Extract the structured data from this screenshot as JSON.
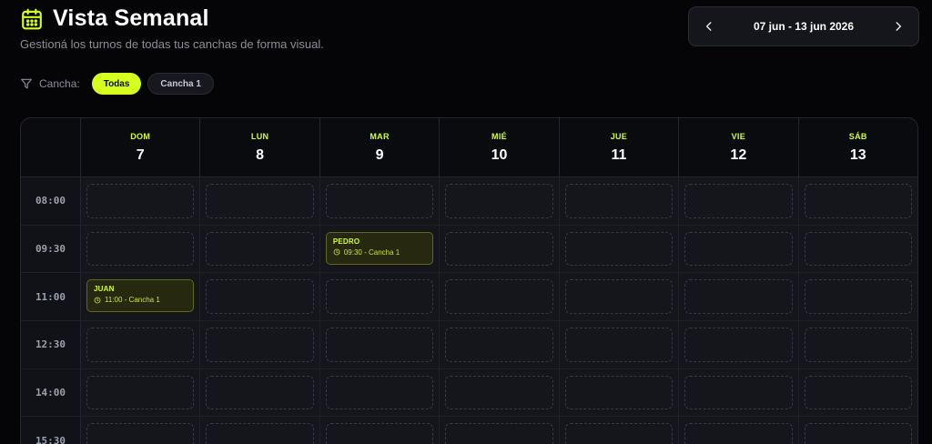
{
  "header": {
    "title": "Vista Semanal",
    "subtitle": "Gestioná los turnos de todas tus canchas de forma visual.",
    "icon": "calendar-icon"
  },
  "week_nav": {
    "range": "07 jun - 13 jun 2026",
    "prev_icon": "chevron-left-icon",
    "next_icon": "chevron-right-icon"
  },
  "filters": {
    "label": "Cancha:",
    "icon": "filter-icon",
    "options": [
      {
        "label": "Todas",
        "active": true
      },
      {
        "label": "Cancha 1",
        "active": false
      }
    ]
  },
  "calendar": {
    "days": [
      {
        "name": "DOM",
        "num": "7"
      },
      {
        "name": "LUN",
        "num": "8"
      },
      {
        "name": "MAR",
        "num": "9"
      },
      {
        "name": "MIÉ",
        "num": "10"
      },
      {
        "name": "JUE",
        "num": "11"
      },
      {
        "name": "VIE",
        "num": "12"
      },
      {
        "name": "SÁB",
        "num": "13"
      }
    ],
    "times": [
      "08:00",
      "09:30",
      "11:00",
      "12:30",
      "14:00",
      "15:30"
    ],
    "bookings": [
      {
        "time_index": 1,
        "day_index": 2,
        "name": "PEDRO",
        "meta": "09:30 - Cancha 1"
      },
      {
        "time_index": 2,
        "day_index": 0,
        "name": "JUAN",
        "meta": "11:00 - Cancha 1"
      }
    ]
  },
  "colors": {
    "accent": "#d4ff1f",
    "background": "#050507",
    "booking_bg": "#26290f"
  }
}
